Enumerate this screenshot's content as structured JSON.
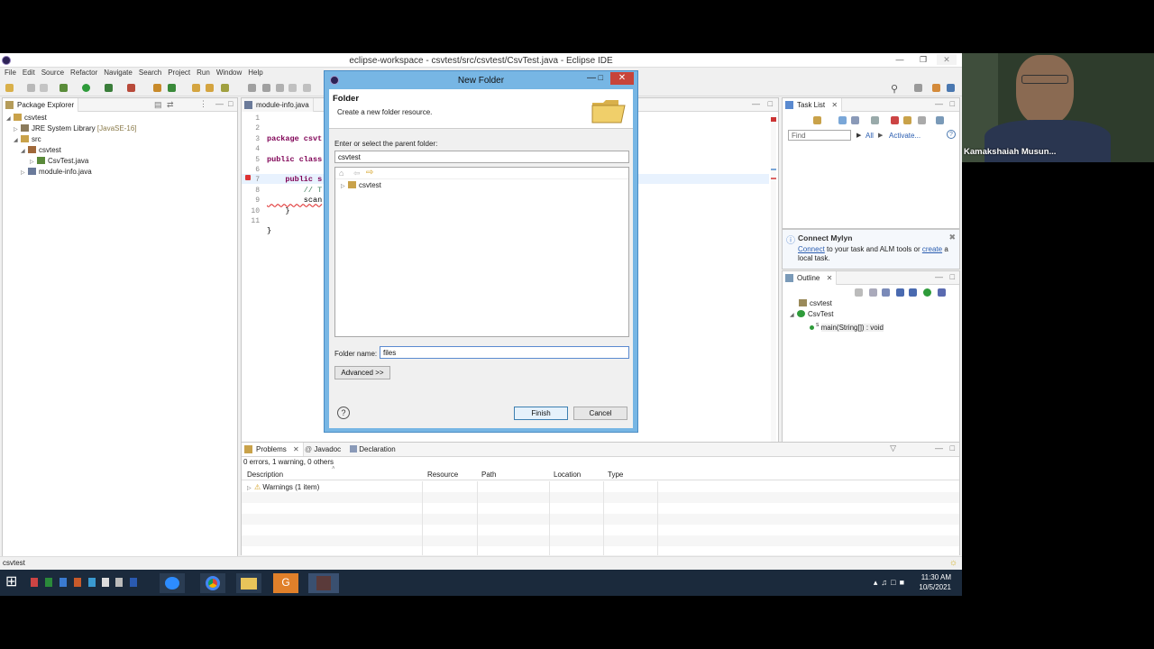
{
  "window": {
    "title": "eclipse-workspace - csvtest/src/csvtest/CsvTest.java - Eclipse IDE"
  },
  "menu": [
    "File",
    "Edit",
    "Source",
    "Refactor",
    "Navigate",
    "Search",
    "Project",
    "Run",
    "Window",
    "Help"
  ],
  "package_explorer": {
    "tab": "Package Explorer",
    "items": [
      "csvtest",
      "JRE System Library",
      "[JavaSE-16]",
      "src",
      "csvtest",
      "CsvTest.java",
      "module-info.java"
    ]
  },
  "editor": {
    "tab": "module-info.java",
    "line_numbers": [
      "1",
      "2",
      "3",
      "4",
      "5",
      "6",
      "7",
      "8",
      "9",
      "10",
      "11"
    ],
    "lines": [
      "package csvt",
      "",
      "public class",
      "",
      "    public s",
      "        // T",
      "        scan",
      "    }",
      "",
      "}",
      ""
    ]
  },
  "task_list": {
    "tab": "Task List",
    "find_placeholder": "Find",
    "all": "All",
    "activate": "Activate..."
  },
  "mylyn": {
    "title": "Connect Mylyn",
    "connect": "Connect",
    "text1": " to your task and ALM tools or ",
    "create": "create",
    "text2": " a",
    "text3": "local task."
  },
  "outline": {
    "tab": "Outline",
    "items": [
      "csvtest",
      "CsvTest",
      "main(String[]) : void"
    ],
    "static_marker": "S"
  },
  "problems": {
    "tabs": [
      "Problems",
      "Javadoc",
      "Declaration"
    ],
    "summary": "0 errors, 1 warning, 0 others",
    "columns": [
      "Description",
      "Resource",
      "Path",
      "Location",
      "Type"
    ],
    "rows": [
      {
        "description": "Warnings (1 item)"
      }
    ]
  },
  "status_bar": {
    "text": "csvtest"
  },
  "dialog": {
    "title": "New Folder",
    "heading": "Folder",
    "subheading": "Create a new folder resource.",
    "parent_label": "Enter or select the parent folder:",
    "parent_value": "csvtest",
    "tree_item": "csvtest",
    "folder_name_label": "Folder name:",
    "folder_name_value": "files",
    "advanced_button": "Advanced >>",
    "finish_button": "Finish",
    "cancel_button": "Cancel",
    "help_symbol": "?"
  },
  "taskbar": {
    "time": "11:30 AM",
    "date": "10/5/2021"
  },
  "webcam": {
    "name": "Kamakshaiah Musun..."
  }
}
